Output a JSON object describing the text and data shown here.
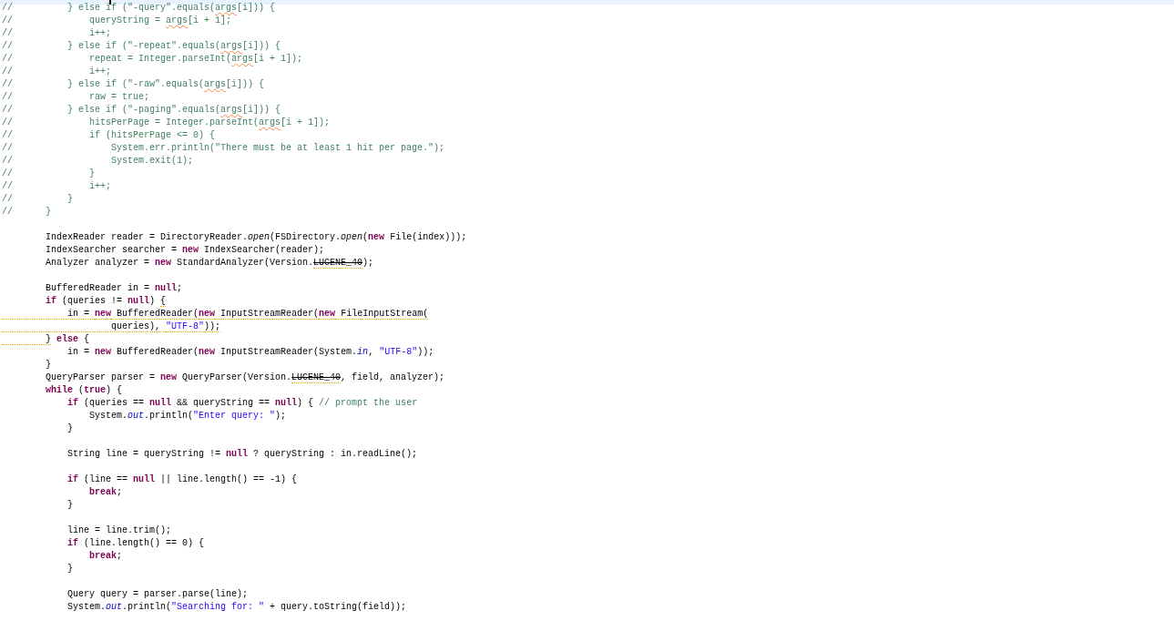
{
  "editor": {
    "blocks": [
      {
        "lines": [
          {
            "tokens": [
              {
                "text": "//          } else if (\"-query\".equals(",
                "kind": "comment"
              },
              {
                "text": "args",
                "kind": "comment",
                "misspelled": true
              },
              {
                "text": "[i])) {",
                "kind": "comment"
              }
            ]
          },
          {
            "tokens": [
              {
                "text": "//              queryString = ",
                "kind": "comment"
              },
              {
                "text": "args",
                "kind": "comment",
                "misspelled": true
              },
              {
                "text": "[i + 1];",
                "kind": "comment"
              }
            ]
          },
          {
            "tokens": [
              {
                "text": "//              i++;",
                "kind": "comment"
              }
            ]
          },
          {
            "tokens": [
              {
                "text": "//          } else if (\"-repeat\".equals(",
                "kind": "comment"
              },
              {
                "text": "args",
                "kind": "comment",
                "misspelled": true
              },
              {
                "text": "[i])) {",
                "kind": "comment"
              }
            ]
          },
          {
            "tokens": [
              {
                "text": "//              repeat = Integer.parseInt(",
                "kind": "comment"
              },
              {
                "text": "args",
                "kind": "comment",
                "misspelled": true
              },
              {
                "text": "[i + 1]);",
                "kind": "comment"
              }
            ]
          },
          {
            "tokens": [
              {
                "text": "//              i++;",
                "kind": "comment"
              }
            ]
          },
          {
            "tokens": [
              {
                "text": "//          } else if (\"-raw\".equals(",
                "kind": "comment"
              },
              {
                "text": "args",
                "kind": "comment",
                "misspelled": true
              },
              {
                "text": "[i])) {",
                "kind": "comment"
              }
            ]
          },
          {
            "tokens": [
              {
                "text": "//              raw = true;",
                "kind": "comment"
              }
            ]
          },
          {
            "tokens": [
              {
                "text": "//          } else if (\"-paging\".equals(",
                "kind": "comment"
              },
              {
                "text": "args",
                "kind": "comment",
                "misspelled": true
              },
              {
                "text": "[i])) {",
                "kind": "comment"
              }
            ]
          },
          {
            "tokens": [
              {
                "text": "//              hitsPerPage = Integer.parseInt(",
                "kind": "comment"
              },
              {
                "text": "args",
                "kind": "comment",
                "misspelled": true
              },
              {
                "text": "[i + 1]);",
                "kind": "comment"
              }
            ]
          },
          {
            "tokens": [
              {
                "text": "//              if (hitsPerPage <= 0) {",
                "kind": "comment"
              }
            ]
          },
          {
            "tokens": [
              {
                "text": "//                  System.err.println(\"There must be at least 1 hit per page.\");",
                "kind": "comment"
              }
            ]
          },
          {
            "tokens": [
              {
                "text": "//                  System.exit(1);",
                "kind": "comment"
              }
            ]
          },
          {
            "tokens": [
              {
                "text": "//              }",
                "kind": "comment"
              }
            ]
          },
          {
            "tokens": [
              {
                "text": "//              i++;",
                "kind": "comment"
              }
            ]
          },
          {
            "tokens": [
              {
                "text": "//          }",
                "kind": "comment"
              }
            ]
          },
          {
            "tokens": [
              {
                "text": "//      }",
                "kind": "comment"
              }
            ]
          }
        ]
      },
      {
        "lines": [
          {
            "tokens": [
              {
                "text": "        IndexReader reader = DirectoryReader.",
                "kind": "plain"
              },
              {
                "text": "open",
                "kind": "method"
              },
              {
                "text": "(FSDirectory.",
                "kind": "plain"
              },
              {
                "text": "open",
                "kind": "method"
              },
              {
                "text": "(",
                "kind": "plain"
              },
              {
                "text": "new",
                "kind": "keyword"
              },
              {
                "text": " File(index)));",
                "kind": "plain"
              }
            ]
          },
          {
            "tokens": [
              {
                "text": "        IndexSearcher searcher = ",
                "kind": "plain"
              },
              {
                "text": "new",
                "kind": "keyword"
              },
              {
                "text": " IndexSearcher(reader);",
                "kind": "plain"
              }
            ]
          },
          {
            "tokens": [
              {
                "text": "        Analyzer analyzer = ",
                "kind": "plain"
              },
              {
                "text": "new",
                "kind": "keyword"
              },
              {
                "text": " StandardAnalyzer(Version.",
                "kind": "plain"
              },
              {
                "text": "LUCENE_40",
                "kind": "plain",
                "deprecated": true
              },
              {
                "text": ");",
                "kind": "plain"
              }
            ]
          }
        ]
      },
      {
        "lines": [
          {
            "tokens": [
              {
                "text": "        BufferedReader in = ",
                "kind": "plain"
              },
              {
                "text": "null",
                "kind": "keyword"
              },
              {
                "text": ";",
                "kind": "plain"
              }
            ]
          },
          {
            "tokens": [
              {
                "text": "        if",
                "kind": "keyword"
              },
              {
                "text": " (queries != ",
                "kind": "plain"
              },
              {
                "text": "null",
                "kind": "keyword"
              },
              {
                "text": ") ",
                "kind": "plain"
              },
              {
                "text": "{",
                "kind": "plain",
                "warning": true
              }
            ]
          },
          {
            "tokens": [
              {
                "text": "            in = ",
                "kind": "plain",
                "warning": true
              },
              {
                "text": "new",
                "kind": "keyword",
                "warning": true
              },
              {
                "text": " BufferedReader(",
                "kind": "plain",
                "warning": true
              },
              {
                "text": "new",
                "kind": "keyword",
                "warning": true
              },
              {
                "text": " InputStreamReader(",
                "kind": "plain",
                "warning": true
              },
              {
                "text": "new",
                "kind": "keyword",
                "warning": true
              },
              {
                "text": " FileInputStream(",
                "kind": "plain",
                "warning": true
              }
            ]
          },
          {
            "tokens": [
              {
                "text": "                    queries), ",
                "kind": "plain",
                "warning": true
              },
              {
                "text": "\"UTF-8\"",
                "kind": "string",
                "warning": true
              },
              {
                "text": "));",
                "kind": "plain",
                "warning": true
              }
            ]
          },
          {
            "tokens": [
              {
                "text": "        }",
                "kind": "plain",
                "warning": true
              },
              {
                "text": " else",
                "kind": "keyword"
              },
              {
                "text": " {",
                "kind": "plain"
              }
            ]
          },
          {
            "tokens": [
              {
                "text": "            in = ",
                "kind": "plain"
              },
              {
                "text": "new",
                "kind": "keyword"
              },
              {
                "text": " BufferedReader(",
                "kind": "plain"
              },
              {
                "text": "new",
                "kind": "keyword"
              },
              {
                "text": " InputStreamReader(System.",
                "kind": "plain"
              },
              {
                "text": "in",
                "kind": "field"
              },
              {
                "text": ", ",
                "kind": "plain"
              },
              {
                "text": "\"UTF-8\"",
                "kind": "string"
              },
              {
                "text": "));",
                "kind": "plain"
              }
            ]
          },
          {
            "tokens": [
              {
                "text": "        }",
                "kind": "plain"
              }
            ]
          },
          {
            "tokens": [
              {
                "text": "        QueryParser parser = ",
                "kind": "plain"
              },
              {
                "text": "new",
                "kind": "keyword"
              },
              {
                "text": " QueryParser(Version.",
                "kind": "plain"
              },
              {
                "text": "LUCENE_40",
                "kind": "plain",
                "deprecated": true
              },
              {
                "text": ", field, analyzer);",
                "kind": "plain"
              }
            ]
          },
          {
            "tokens": [
              {
                "text": "        while",
                "kind": "keyword"
              },
              {
                "text": " (",
                "kind": "plain"
              },
              {
                "text": "true",
                "kind": "keyword"
              },
              {
                "text": ") {",
                "kind": "plain"
              }
            ]
          },
          {
            "tokens": [
              {
                "text": "            if",
                "kind": "keyword"
              },
              {
                "text": " (queries == ",
                "kind": "plain"
              },
              {
                "text": "null",
                "kind": "keyword"
              },
              {
                "text": " && queryString == ",
                "kind": "plain"
              },
              {
                "text": "null",
                "kind": "keyword"
              },
              {
                "text": ") { ",
                "kind": "plain"
              },
              {
                "text": "// prompt the user",
                "kind": "comment"
              }
            ]
          },
          {
            "tokens": [
              {
                "text": "                System.",
                "kind": "plain"
              },
              {
                "text": "out",
                "kind": "field"
              },
              {
                "text": ".println(",
                "kind": "plain"
              },
              {
                "text": "\"Enter query: \"",
                "kind": "string"
              },
              {
                "text": ");",
                "kind": "plain"
              }
            ]
          },
          {
            "tokens": [
              {
                "text": "            }",
                "kind": "plain"
              }
            ]
          }
        ]
      },
      {
        "lines": [
          {
            "tokens": [
              {
                "text": "            String line = queryString != ",
                "kind": "plain"
              },
              {
                "text": "null",
                "kind": "keyword"
              },
              {
                "text": " ? queryString : in.readLine();",
                "kind": "plain"
              }
            ]
          }
        ]
      },
      {
        "lines": [
          {
            "tokens": [
              {
                "text": "            if",
                "kind": "keyword"
              },
              {
                "text": " (line == ",
                "kind": "plain"
              },
              {
                "text": "null",
                "kind": "keyword"
              },
              {
                "text": " || line.length() == -1) {",
                "kind": "plain"
              }
            ]
          },
          {
            "tokens": [
              {
                "text": "                break",
                "kind": "keyword"
              },
              {
                "text": ";",
                "kind": "plain"
              }
            ]
          },
          {
            "tokens": [
              {
                "text": "            }",
                "kind": "plain"
              }
            ]
          }
        ]
      },
      {
        "lines": [
          {
            "tokens": [
              {
                "text": "            line = line.trim();",
                "kind": "plain"
              }
            ]
          },
          {
            "tokens": [
              {
                "text": "            if",
                "kind": "keyword"
              },
              {
                "text": " (line.length() == 0) {",
                "kind": "plain"
              }
            ]
          },
          {
            "tokens": [
              {
                "text": "                break",
                "kind": "keyword"
              },
              {
                "text": ";",
                "kind": "plain"
              }
            ]
          },
          {
            "tokens": [
              {
                "text": "            }",
                "kind": "plain"
              }
            ]
          }
        ]
      },
      {
        "lines": [
          {
            "tokens": [
              {
                "text": "            Query query = parser.parse(line);",
                "kind": "plain"
              }
            ]
          },
          {
            "tokens": [
              {
                "text": "            System.",
                "kind": "plain"
              },
              {
                "text": "out",
                "kind": "field"
              },
              {
                "text": ".println(",
                "kind": "plain"
              },
              {
                "text": "\"Searching for: \"",
                "kind": "string"
              },
              {
                "text": " + query.toString(field));",
                "kind": "plain"
              }
            ]
          }
        ]
      }
    ]
  }
}
